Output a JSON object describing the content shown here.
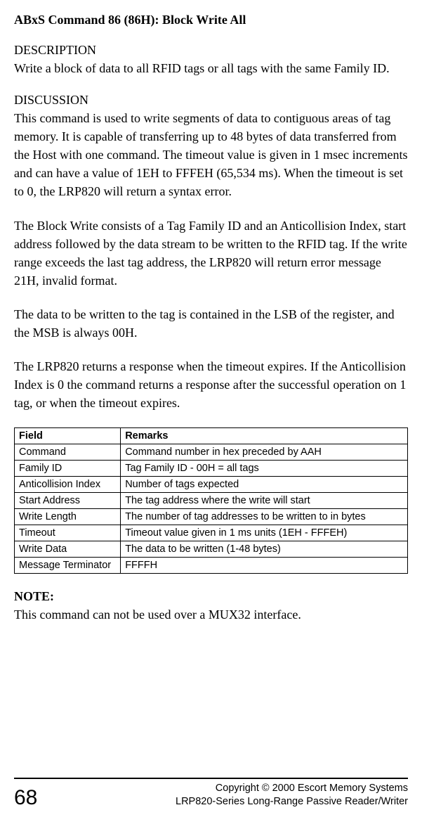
{
  "title": "ABxS Command 86 (86H): Block Write All",
  "desc_label": "DESCRIPTION",
  "desc_text": "Write a block of data to all RFID tags or all tags with the same Family ID.",
  "disc_label": "DISCUSSION",
  "disc_p1": "This command is used to write segments of data to contiguous areas of tag memory. It is capable of transferring up to 48 bytes of data transferred from the Host with one command.  The timeout value is given in 1 msec increments and can have a value of 1EH to FFFEH (65,534 ms). When the timeout is set to 0, the LRP820 will return a syntax error.",
  "disc_p2": "The Block Write consists of a Tag Family ID and an Anticollision Index, start address followed by the data stream to be written to the RFID tag. If the write range exceeds the last tag address, the LRP820 will return error message 21H, invalid format.",
  "disc_p3": "The data to be written to the tag is contained in the LSB of the register, and the MSB is always 00H.",
  "disc_p4": "The LRP820 returns a response when the timeout expires.  If the Anticollision Index is 0 the command returns a response after the successful operation on 1 tag, or when the timeout expires.",
  "table": {
    "headers": {
      "field": "Field",
      "remarks": "Remarks"
    },
    "rows": [
      {
        "field": "Command",
        "remarks": "Command number in hex preceded by AAH"
      },
      {
        "field": "Family ID",
        "remarks": "Tag Family ID - 00H = all tags"
      },
      {
        "field": "Anticollision Index",
        "remarks": "Number of tags expected"
      },
      {
        "field": "Start Address",
        "remarks": "The tag address where the write will start"
      },
      {
        "field": "Write Length",
        "remarks": "The number of tag addresses to be written to in bytes"
      },
      {
        "field": "Timeout",
        "remarks": "Timeout value given in 1 ms units (1EH - FFFEH)"
      },
      {
        "field": "Write Data",
        "remarks": "The data to be written (1-48 bytes)"
      },
      {
        "field": "Message Terminator",
        "remarks": "FFFFH"
      }
    ]
  },
  "note_label": "NOTE:",
  "note_text": "This command can not be used over a MUX32 interface.",
  "footer": {
    "page": "68",
    "line1": "Copyright © 2000 Escort Memory Systems",
    "line2": "LRP820-Series Long-Range Passive Reader/Writer"
  }
}
